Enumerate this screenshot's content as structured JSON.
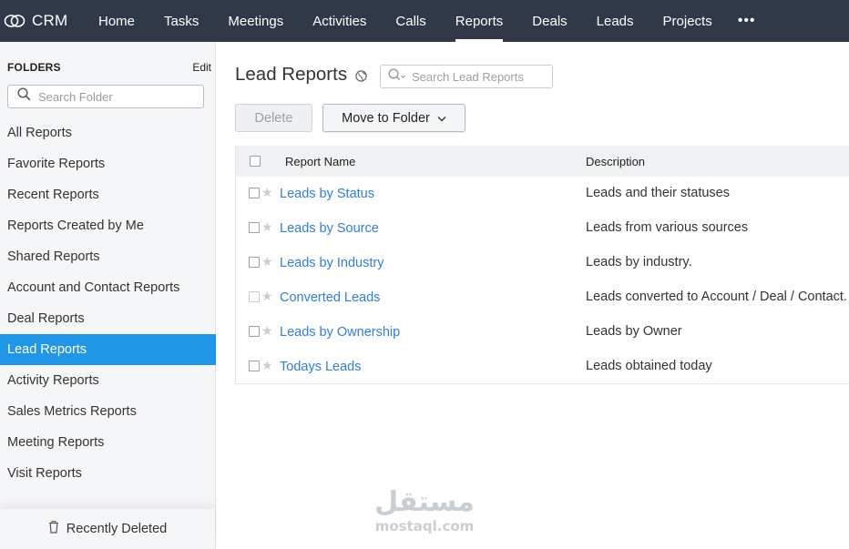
{
  "app": {
    "brand": "CRM",
    "nav": [
      {
        "label": "Home"
      },
      {
        "label": "Tasks"
      },
      {
        "label": "Meetings"
      },
      {
        "label": "Activities"
      },
      {
        "label": "Calls"
      },
      {
        "label": "Reports",
        "active": true
      },
      {
        "label": "Deals"
      },
      {
        "label": "Leads"
      },
      {
        "label": "Projects"
      }
    ],
    "more_label": "•••"
  },
  "sidebar": {
    "title": "FOLDERS",
    "edit_label": "Edit",
    "search_placeholder": "Search Folder",
    "items": [
      {
        "label": "All Reports"
      },
      {
        "label": "Favorite Reports"
      },
      {
        "label": "Recent Reports"
      },
      {
        "label": "Reports Created by Me"
      },
      {
        "label": "Shared Reports"
      },
      {
        "label": "Account and Contact Reports"
      },
      {
        "label": "Deal Reports"
      },
      {
        "label": "Lead Reports",
        "active": true
      },
      {
        "label": "Activity Reports"
      },
      {
        "label": "Sales Metrics Reports"
      },
      {
        "label": "Meeting Reports"
      },
      {
        "label": "Visit Reports"
      }
    ],
    "recently_deleted": "Recently Deleted"
  },
  "main": {
    "title": "Lead Reports",
    "search_placeholder": "Search Lead Reports",
    "delete_label": "Delete",
    "move_label": "Move to Folder",
    "columns": {
      "name": "Report Name",
      "description": "Description"
    },
    "rows": [
      {
        "name": "Leads by Status",
        "description": "Leads and their statuses"
      },
      {
        "name": "Leads by Source",
        "description": "Leads from various sources"
      },
      {
        "name": "Leads by Industry",
        "description": "Leads by industry."
      },
      {
        "name": "Converted Leads",
        "description": "Leads converted to Account / Deal / Contact."
      },
      {
        "name": "Leads by Ownership",
        "description": "Leads by Owner"
      },
      {
        "name": "Todays Leads",
        "description": "Leads obtained today"
      }
    ]
  },
  "watermark": {
    "arabic": "مستقل",
    "latin": "mostaql.com"
  },
  "colors": {
    "topbar": "#313949",
    "accent": "#2196e6",
    "link": "#2e7fd5"
  },
  "icons": [
    "crm-logo-icon",
    "search-icon",
    "globe-icon",
    "chevron-down-icon",
    "star-icon",
    "trash-icon",
    "more-icon"
  ]
}
